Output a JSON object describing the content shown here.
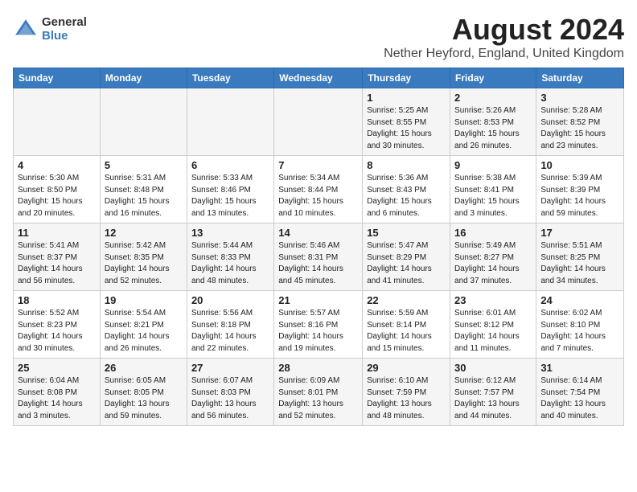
{
  "header": {
    "logo_general": "General",
    "logo_blue": "Blue",
    "title": "August 2024",
    "subtitle": "Nether Heyford, England, United Kingdom"
  },
  "weekdays": [
    "Sunday",
    "Monday",
    "Tuesday",
    "Wednesday",
    "Thursday",
    "Friday",
    "Saturday"
  ],
  "weeks": [
    [
      {
        "day": "",
        "info": ""
      },
      {
        "day": "",
        "info": ""
      },
      {
        "day": "",
        "info": ""
      },
      {
        "day": "",
        "info": ""
      },
      {
        "day": "1",
        "info": "Sunrise: 5:25 AM\nSunset: 8:55 PM\nDaylight: 15 hours\nand 30 minutes."
      },
      {
        "day": "2",
        "info": "Sunrise: 5:26 AM\nSunset: 8:53 PM\nDaylight: 15 hours\nand 26 minutes."
      },
      {
        "day": "3",
        "info": "Sunrise: 5:28 AM\nSunset: 8:52 PM\nDaylight: 15 hours\nand 23 minutes."
      }
    ],
    [
      {
        "day": "4",
        "info": "Sunrise: 5:30 AM\nSunset: 8:50 PM\nDaylight: 15 hours\nand 20 minutes."
      },
      {
        "day": "5",
        "info": "Sunrise: 5:31 AM\nSunset: 8:48 PM\nDaylight: 15 hours\nand 16 minutes."
      },
      {
        "day": "6",
        "info": "Sunrise: 5:33 AM\nSunset: 8:46 PM\nDaylight: 15 hours\nand 13 minutes."
      },
      {
        "day": "7",
        "info": "Sunrise: 5:34 AM\nSunset: 8:44 PM\nDaylight: 15 hours\nand 10 minutes."
      },
      {
        "day": "8",
        "info": "Sunrise: 5:36 AM\nSunset: 8:43 PM\nDaylight: 15 hours\nand 6 minutes."
      },
      {
        "day": "9",
        "info": "Sunrise: 5:38 AM\nSunset: 8:41 PM\nDaylight: 15 hours\nand 3 minutes."
      },
      {
        "day": "10",
        "info": "Sunrise: 5:39 AM\nSunset: 8:39 PM\nDaylight: 14 hours\nand 59 minutes."
      }
    ],
    [
      {
        "day": "11",
        "info": "Sunrise: 5:41 AM\nSunset: 8:37 PM\nDaylight: 14 hours\nand 56 minutes."
      },
      {
        "day": "12",
        "info": "Sunrise: 5:42 AM\nSunset: 8:35 PM\nDaylight: 14 hours\nand 52 minutes."
      },
      {
        "day": "13",
        "info": "Sunrise: 5:44 AM\nSunset: 8:33 PM\nDaylight: 14 hours\nand 48 minutes."
      },
      {
        "day": "14",
        "info": "Sunrise: 5:46 AM\nSunset: 8:31 PM\nDaylight: 14 hours\nand 45 minutes."
      },
      {
        "day": "15",
        "info": "Sunrise: 5:47 AM\nSunset: 8:29 PM\nDaylight: 14 hours\nand 41 minutes."
      },
      {
        "day": "16",
        "info": "Sunrise: 5:49 AM\nSunset: 8:27 PM\nDaylight: 14 hours\nand 37 minutes."
      },
      {
        "day": "17",
        "info": "Sunrise: 5:51 AM\nSunset: 8:25 PM\nDaylight: 14 hours\nand 34 minutes."
      }
    ],
    [
      {
        "day": "18",
        "info": "Sunrise: 5:52 AM\nSunset: 8:23 PM\nDaylight: 14 hours\nand 30 minutes."
      },
      {
        "day": "19",
        "info": "Sunrise: 5:54 AM\nSunset: 8:21 PM\nDaylight: 14 hours\nand 26 minutes."
      },
      {
        "day": "20",
        "info": "Sunrise: 5:56 AM\nSunset: 8:18 PM\nDaylight: 14 hours\nand 22 minutes."
      },
      {
        "day": "21",
        "info": "Sunrise: 5:57 AM\nSunset: 8:16 PM\nDaylight: 14 hours\nand 19 minutes."
      },
      {
        "day": "22",
        "info": "Sunrise: 5:59 AM\nSunset: 8:14 PM\nDaylight: 14 hours\nand 15 minutes."
      },
      {
        "day": "23",
        "info": "Sunrise: 6:01 AM\nSunset: 8:12 PM\nDaylight: 14 hours\nand 11 minutes."
      },
      {
        "day": "24",
        "info": "Sunrise: 6:02 AM\nSunset: 8:10 PM\nDaylight: 14 hours\nand 7 minutes."
      }
    ],
    [
      {
        "day": "25",
        "info": "Sunrise: 6:04 AM\nSunset: 8:08 PM\nDaylight: 14 hours\nand 3 minutes."
      },
      {
        "day": "26",
        "info": "Sunrise: 6:05 AM\nSunset: 8:05 PM\nDaylight: 13 hours\nand 59 minutes."
      },
      {
        "day": "27",
        "info": "Sunrise: 6:07 AM\nSunset: 8:03 PM\nDaylight: 13 hours\nand 56 minutes."
      },
      {
        "day": "28",
        "info": "Sunrise: 6:09 AM\nSunset: 8:01 PM\nDaylight: 13 hours\nand 52 minutes."
      },
      {
        "day": "29",
        "info": "Sunrise: 6:10 AM\nSunset: 7:59 PM\nDaylight: 13 hours\nand 48 minutes."
      },
      {
        "day": "30",
        "info": "Sunrise: 6:12 AM\nSunset: 7:57 PM\nDaylight: 13 hours\nand 44 minutes."
      },
      {
        "day": "31",
        "info": "Sunrise: 6:14 AM\nSunset: 7:54 PM\nDaylight: 13 hours\nand 40 minutes."
      }
    ]
  ]
}
